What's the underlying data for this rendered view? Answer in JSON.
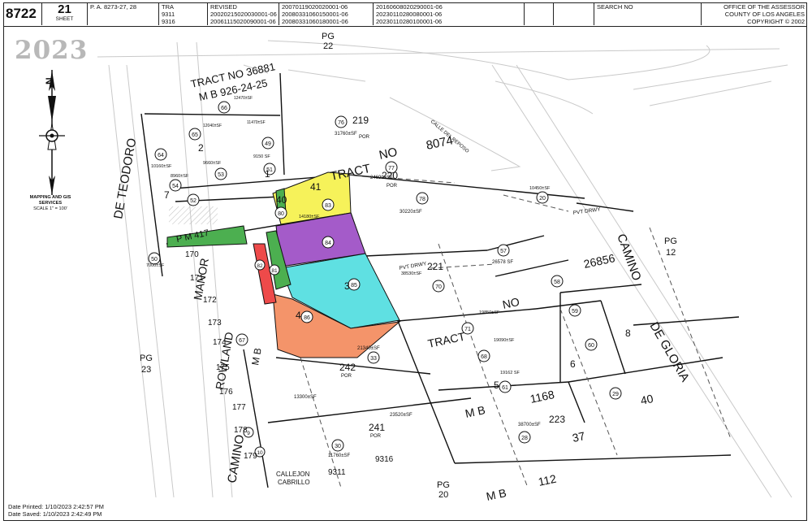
{
  "header": {
    "map_book": "8722",
    "sheet_number": "21",
    "sheet_label": "SHEET",
    "plat_reference": "P. A. 8273-27, 28",
    "tra_label": "TRA",
    "tra_codes": [
      "9311",
      "9316"
    ],
    "revised_label": "REVISED",
    "revised_a": [
      "20020215020030001-06",
      "20061115020090001-06"
    ],
    "revised_b": [
      "20070119020020001-06",
      "20080331060150001-06",
      "20080331060180001-06"
    ],
    "revised_c": [
      "20160608020290001-06",
      "20230110280080001-06",
      "20230110280100001-06"
    ],
    "search_label": "SEARCH NO",
    "office": [
      "OFFICE OF THE ASSESSOR",
      "COUNTY OF LOS ANGELES",
      "COPYRIGHT © 2002"
    ]
  },
  "watermark_year": "2023",
  "mapping_note": {
    "lines": [
      "MAPPING AND GIS",
      "SERVICES"
    ],
    "scale": "SCALE 1\" = 100'"
  },
  "footer": {
    "printed": "Date Printed: 1/10/2023 2:42:57 PM",
    "saved": "Date Saved: 1/10/2023 2:42:49 PM"
  },
  "highlight_colors": {
    "yellow": "#f6f25a",
    "purple": "#a45bc9",
    "cyan": "#5fe0e2",
    "orange": "#f4946a",
    "green": "#4caf50",
    "red": "#ee4a4a"
  },
  "map": {
    "streets": [
      {
        "name": "DE TEODORO"
      },
      {
        "name": "CAMINO"
      },
      {
        "name": "DE GLORIA"
      },
      {
        "name": "CAMINO"
      },
      {
        "name": "ROWLAND"
      },
      {
        "name": "MANOR"
      },
      {
        "name": "CALLEJON"
      },
      {
        "name": "CABRILLO"
      },
      {
        "name": "CALLE DEL REPOSO"
      }
    ],
    "tract_labels": [
      {
        "text": "TRACT NO 36881"
      },
      {
        "text": "M B 926-24-25"
      },
      {
        "text": "TRACT"
      },
      {
        "text": "NO"
      },
      {
        "text": "8074"
      },
      {
        "text": "TRACT"
      },
      {
        "text": "NO"
      },
      {
        "text": "26856"
      },
      {
        "text": "M B"
      },
      {
        "text": "1168"
      },
      {
        "text": "M B"
      },
      {
        "text": "112"
      },
      {
        "text": "37"
      },
      {
        "text": "40"
      },
      {
        "text": "P M 417"
      },
      {
        "text": "M B"
      }
    ],
    "page_refs": [
      {
        "text": "PG"
      },
      {
        "text": "22"
      },
      {
        "text": "PG"
      },
      {
        "text": "12"
      },
      {
        "text": "PG"
      },
      {
        "text": "23"
      },
      {
        "text": "PG"
      },
      {
        "text": "20"
      }
    ],
    "parcels": [
      {
        "no": "64",
        "area": "10160±SF"
      },
      {
        "no": "65",
        "area": "12040±SF"
      },
      {
        "no": "66",
        "area": "12470±SF"
      },
      {
        "no": "49",
        "area": "11470±SF"
      },
      {
        "no": "53",
        "area": "9660±SF"
      },
      {
        "no": "52",
        "area": "8960±SF"
      },
      {
        "no": "54",
        "area": ""
      },
      {
        "no": "51",
        "area": "9150 SF"
      },
      {
        "no": "76",
        "area": "31760±SF"
      },
      {
        "no": "77",
        "area": "24690±SF"
      },
      {
        "no": "78",
        "area": "30220±SF"
      },
      {
        "no": "80",
        "area": ""
      },
      {
        "no": "83",
        "area": "14180±SF"
      },
      {
        "no": "84",
        "area": ""
      },
      {
        "no": "85",
        "area": ""
      },
      {
        "no": "86",
        "area": ""
      },
      {
        "no": "81",
        "area": ""
      },
      {
        "no": "82",
        "area": ""
      },
      {
        "no": "50",
        "area": "7000±SF"
      },
      {
        "no": "70",
        "area": "38530±SF"
      },
      {
        "no": "57",
        "area": "26578 SF"
      },
      {
        "no": "58",
        "area": ""
      },
      {
        "no": "59",
        "area": ""
      },
      {
        "no": "60",
        "area": ""
      },
      {
        "no": "61",
        "area": "19162 SF"
      },
      {
        "no": "68",
        "area": "19090±SF"
      },
      {
        "no": "71",
        "area": "19850±SF"
      },
      {
        "no": "33",
        "area": "21340±SF"
      },
      {
        "no": "29",
        "area": ""
      },
      {
        "no": "28",
        "area": "38700±SF"
      },
      {
        "no": "30",
        "area": "11760±SF"
      },
      {
        "no": "20",
        "area": "10450±SF"
      },
      {
        "no": "67",
        "area": ""
      },
      {
        "no": "10",
        "area": ""
      },
      {
        "no": "9",
        "area": ""
      }
    ],
    "lot_numbers": [
      "1",
      "2",
      "3",
      "4",
      "5",
      "6",
      "7",
      "8",
      "40",
      "41",
      "170",
      "171",
      "172",
      "173",
      "174",
      "175",
      "176",
      "177",
      "178",
      "179",
      "219",
      "220",
      "221",
      "223",
      "241",
      "242",
      "9311",
      "9316"
    ],
    "misc_text": [
      "POR",
      "PVT DRWY",
      "13300±SF",
      "23520±SF"
    ]
  }
}
